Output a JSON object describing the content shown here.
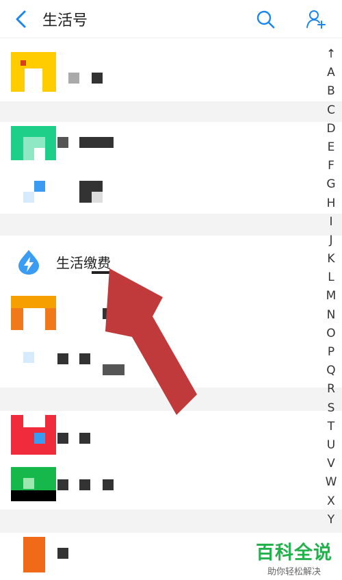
{
  "header": {
    "title": "生活号",
    "back_icon": "chevron-left-icon",
    "search_icon": "search-icon",
    "add_icon": "add-user-icon",
    "accent_color": "#1a86ee"
  },
  "list": {
    "highlighted_item": {
      "label": "生活缴费",
      "icon": "water-drop-bolt-icon",
      "icon_color": "#3b9cf3"
    }
  },
  "index_bar": {
    "letters": [
      "↑",
      "A",
      "B",
      "C",
      "D",
      "E",
      "F",
      "G",
      "H",
      "I",
      "J",
      "K",
      "L",
      "M",
      "N",
      "O",
      "P",
      "Q",
      "R",
      "S",
      "T",
      "U",
      "V",
      "W",
      "X",
      "Y"
    ]
  },
  "annotation": {
    "arrow_color": "#c0393b"
  },
  "watermark": {
    "title": "百科全说",
    "subtitle": "助你轻松解决"
  }
}
